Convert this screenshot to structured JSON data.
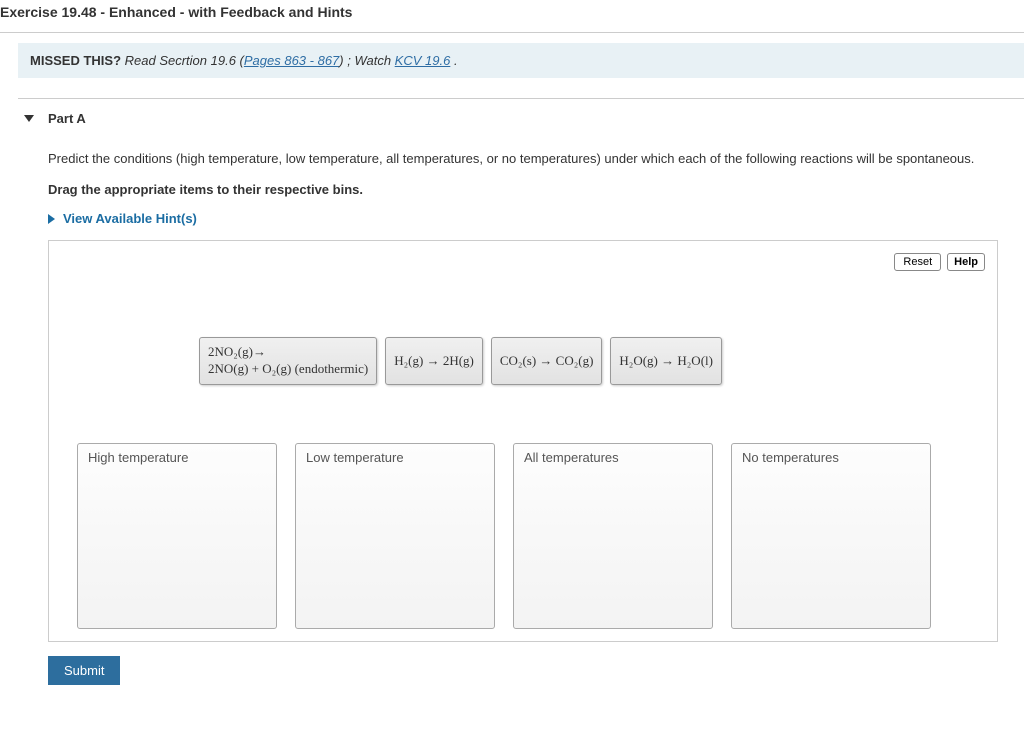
{
  "title": "Exercise 19.48 - Enhanced - with Feedback and Hints",
  "missed": {
    "label": "MISSED THIS?",
    "read_prefix": "Read Secrtion 19.6 (",
    "pages_link": "Pages 863 - 867",
    "read_suffix": ") ; Watch ",
    "watch_link": "KCV 19.6",
    "tail": " ."
  },
  "part": {
    "label": "Part A",
    "prompt": "Predict the conditions (high temperature, low temperature, all temperatures, or no temperatures) under which each of the following reactions will be spontaneous.",
    "instruction": "Drag the appropriate items to their respective bins.",
    "hints_label": "View Available Hint(s)",
    "reset": "Reset",
    "help": "Help",
    "items": [
      {
        "line1": "2NO₂(g)→",
        "line2": "2NO(g) + O₂(g) (endothermic)"
      },
      {
        "line1": "H₂(g) → 2H(g)"
      },
      {
        "line1": "CO₂(s) → CO₂(g)"
      },
      {
        "line1": "H₂O(g) → H₂O(l)"
      }
    ],
    "bins": [
      "High temperature",
      "Low temperature",
      "All temperatures",
      "No temperatures"
    ],
    "submit": "Submit"
  }
}
